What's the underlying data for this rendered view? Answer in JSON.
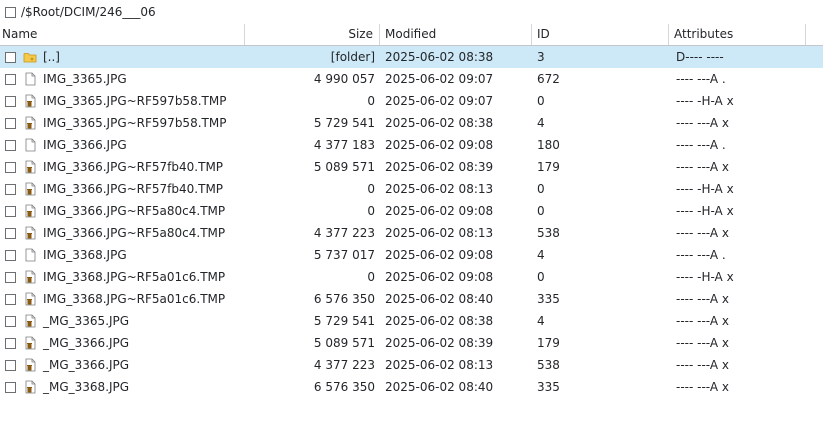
{
  "path": "/$Root/DCIM/246___06",
  "columns": {
    "name": "Name",
    "size": "Size",
    "modified": "Modified",
    "id": "ID",
    "attributes": "Attributes"
  },
  "rows": [
    {
      "name": "[..]",
      "size": "[folder]",
      "modified": "2025-06-02 08:38",
      "id": "3",
      "attr": "D---- ----",
      "icon": "folder-icon"
    },
    {
      "name": "IMG_3365.JPG",
      "size": "4 990 057",
      "modified": "2025-06-02 09:07",
      "id": "672",
      "attr": "---- ---A  .",
      "icon": "file-icon"
    },
    {
      "name": "IMG_3365.JPG~RF597b58.TMP",
      "size": "0",
      "modified": "2025-06-02 09:07",
      "id": "0",
      "attr": "---- -H-A  x",
      "icon": "deleted-file-icon"
    },
    {
      "name": "IMG_3365.JPG~RF597b58.TMP",
      "size": "5 729 541",
      "modified": "2025-06-02 08:38",
      "id": "4",
      "attr": "---- ---A  x",
      "icon": "deleted-file-icon"
    },
    {
      "name": "IMG_3366.JPG",
      "size": "4 377 183",
      "modified": "2025-06-02 09:08",
      "id": "180",
      "attr": "---- ---A  .",
      "icon": "file-icon"
    },
    {
      "name": "IMG_3366.JPG~RF57fb40.TMP",
      "size": "5 089 571",
      "modified": "2025-06-02 08:39",
      "id": "179",
      "attr": "---- ---A  x",
      "icon": "deleted-file-icon"
    },
    {
      "name": "IMG_3366.JPG~RF57fb40.TMP",
      "size": "0",
      "modified": "2025-06-02 08:13",
      "id": "0",
      "attr": "---- -H-A  x",
      "icon": "deleted-file-icon"
    },
    {
      "name": "IMG_3366.JPG~RF5a80c4.TMP",
      "size": "0",
      "modified": "2025-06-02 09:08",
      "id": "0",
      "attr": "---- -H-A  x",
      "icon": "deleted-file-icon"
    },
    {
      "name": "IMG_3366.JPG~RF5a80c4.TMP",
      "size": "4 377 223",
      "modified": "2025-06-02 08:13",
      "id": "538",
      "attr": "---- ---A  x",
      "icon": "deleted-file-icon"
    },
    {
      "name": "IMG_3368.JPG",
      "size": "5 737 017",
      "modified": "2025-06-02 09:08",
      "id": "4",
      "attr": "---- ---A  .",
      "icon": "file-icon"
    },
    {
      "name": "IMG_3368.JPG~RF5a01c6.TMP",
      "size": "0",
      "modified": "2025-06-02 09:08",
      "id": "0",
      "attr": "---- -H-A  x",
      "icon": "deleted-file-icon"
    },
    {
      "name": "IMG_3368.JPG~RF5a01c6.TMP",
      "size": "6 576 350",
      "modified": "2025-06-02 08:40",
      "id": "335",
      "attr": "---- ---A  x",
      "icon": "deleted-file-icon"
    },
    {
      "name": "_MG_3365.JPG",
      "size": "5 729 541",
      "modified": "2025-06-02 08:38",
      "id": "4",
      "attr": "---- ---A  x",
      "icon": "deleted-file-icon"
    },
    {
      "name": "_MG_3366.JPG",
      "size": "5 089 571",
      "modified": "2025-06-02 08:39",
      "id": "179",
      "attr": "---- ---A  x",
      "icon": "deleted-file-icon"
    },
    {
      "name": "_MG_3366.JPG",
      "size": "4 377 223",
      "modified": "2025-06-02 08:13",
      "id": "538",
      "attr": "---- ---A  x",
      "icon": "deleted-file-icon"
    },
    {
      "name": "_MG_3368.JPG",
      "size": "6 576 350",
      "modified": "2025-06-02 08:40",
      "id": "335",
      "attr": "---- ---A  x",
      "icon": "deleted-file-icon"
    }
  ],
  "selected_index": 0,
  "colors": {
    "selection": "#cde8f7",
    "folder": "#f6c94a",
    "deleted_marker": "#8a5a12"
  }
}
